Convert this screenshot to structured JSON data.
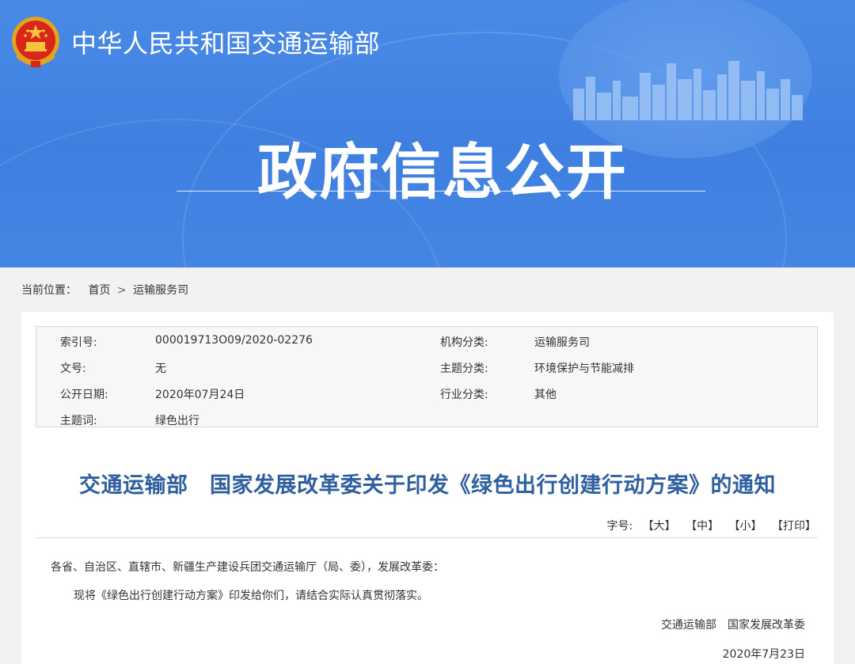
{
  "header": {
    "ministry_name": "中华人民共和国交通运输部",
    "banner_title": "政府信息公开",
    "emblem_icon": "national-emblem-icon"
  },
  "breadcrumb": {
    "label": "当前位置：",
    "items": [
      "首页",
      "运输服务司"
    ],
    "separator": ">"
  },
  "meta": {
    "index_label": "索引号:",
    "index_value": "000019713O09/2020-02276",
    "org_label": "机构分类:",
    "org_value": "运输服务司",
    "docno_label": "文号:",
    "docno_value": "无",
    "topic_label": "主题分类:",
    "topic_value": "环境保护与节能减排",
    "date_label": "公开日期:",
    "date_value": "2020年07月24日",
    "industry_label": "行业分类:",
    "industry_value": "其他",
    "keywords_label": "主题词:",
    "keywords_value": "绿色出行"
  },
  "document": {
    "title": "交通运输部　国家发展改革委关于印发《绿色出行创建行动方案》的通知",
    "font_label": "字号:",
    "font_large": "【大】",
    "font_medium": "【中】",
    "font_small": "【小】",
    "print": "【打印】",
    "recipients": "各省、自治区、直辖市、新疆生产建设兵团交通运输厅（局、委），发展改革委：",
    "paragraph1": "现将《绿色出行创建行动方案》印发给你们，请结合实际认真贯彻落实。",
    "signatories": "交通运输部　国家发展改革委",
    "sign_date": "2020年7月23日"
  },
  "colors": {
    "banner_blue": "#4585e3",
    "title_blue": "#2e5f9e"
  }
}
